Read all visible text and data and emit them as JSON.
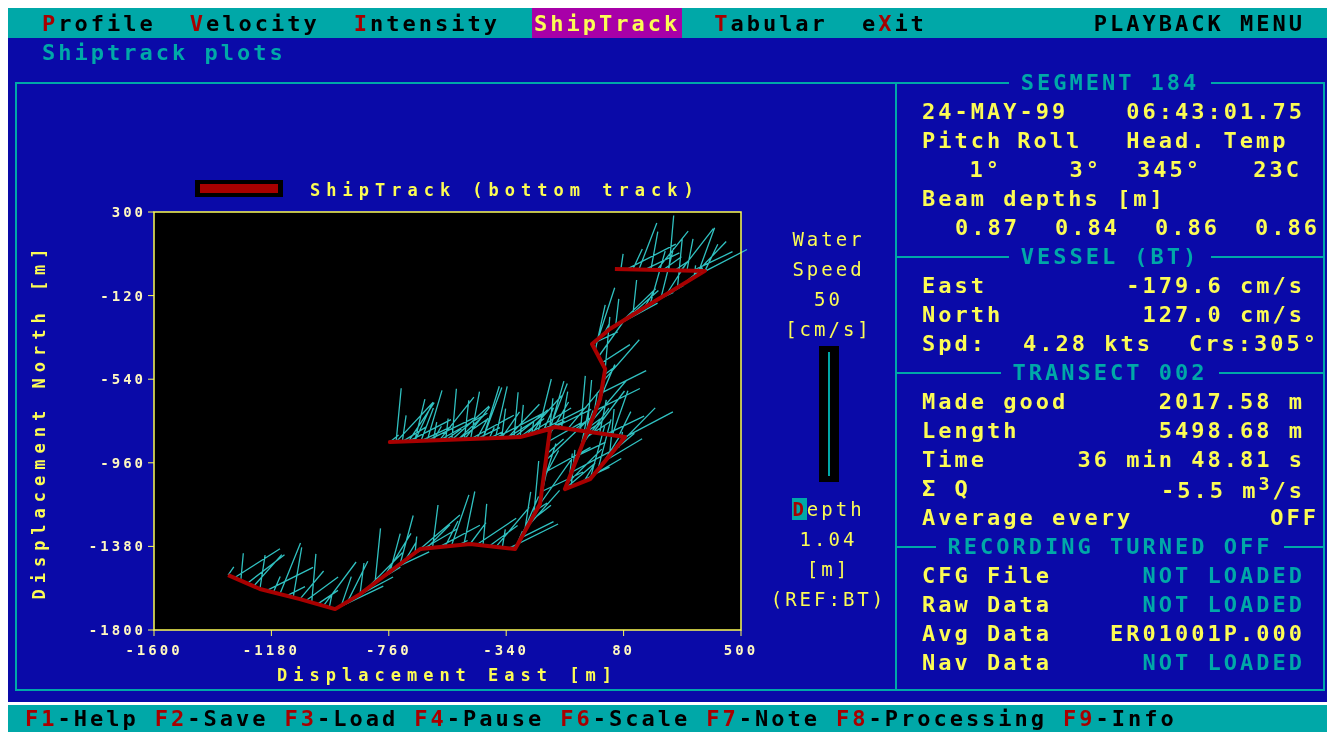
{
  "menu": {
    "items": [
      {
        "key": "P",
        "post": "rofile",
        "selected": false
      },
      {
        "key": "V",
        "post": "elocity",
        "selected": false
      },
      {
        "key": "I",
        "post": "ntensity",
        "selected": false
      },
      {
        "key": "S",
        "post": "hipTrack",
        "selected": true
      },
      {
        "key": "T",
        "post": "abular",
        "selected": false
      },
      {
        "pre": "e",
        "key": "X",
        "post": "it",
        "selected": false
      }
    ],
    "title": "PLAYBACK MENU"
  },
  "subtitle": "Shiptrack plots",
  "chart": {
    "chart_data": {
      "type": "line",
      "xlabel": "Displacement East [m]",
      "ylabel": "Displacement North [m]",
      "xlim": [
        -1600,
        500
      ],
      "ylim": [
        -1800,
        300
      ],
      "xticks": [
        -1600,
        -1180,
        -760,
        -340,
        80,
        500
      ],
      "yticks": [
        300,
        -120,
        -540,
        -960,
        -1380,
        -1800
      ],
      "x": [
        -1335,
        -1221,
        -1078,
        -952,
        -863,
        -648,
        -469,
        -308,
        -219,
        -183,
        -290,
        -756,
        -290,
        -165,
        85,
        -40,
        -130,
        -4,
        14,
        -33,
        31,
        175,
        371,
        49
      ],
      "series": [
        {
          "name": "ShipTrack (bottom track)",
          "color": "#a80000",
          "values": [
            -1524,
            -1594,
            -1645,
            -1695,
            -1620,
            -1393,
            -1368,
            -1393,
            -1167,
            -790,
            -831,
            -856,
            -831,
            -780,
            -831,
            -1042,
            -1092,
            -640,
            -489,
            -363,
            -288,
            -162,
            4,
            14
          ]
        }
      ]
    }
  },
  "water_speed": {
    "label_lines": [
      "Water",
      "Speed"
    ],
    "value": "50",
    "unit": "[cm/s]"
  },
  "depth": {
    "key": "D",
    "rest": "epth",
    "value": "1.04",
    "unit": "[m]",
    "reference": "(REF:BT)"
  },
  "info_panel": {
    "sections": [
      {
        "title": "SEGMENT 184",
        "rows": [
          {
            "kind": "pair",
            "label": "24-MAY-99",
            "value": "06:43:01.75"
          },
          {
            "kind": "headers",
            "cells": [
              "Pitch",
              "Roll",
              "Head.",
              "Temp"
            ]
          },
          {
            "kind": "values",
            "cells": [
              "1°",
              "3°",
              "345°",
              "23C"
            ]
          },
          {
            "kind": "text",
            "label": "Beam depths [m]"
          },
          {
            "kind": "values",
            "cells": [
              "0.87",
              "0.84",
              "0.86",
              "0.86"
            ]
          }
        ]
      },
      {
        "title": "VESSEL (BT)",
        "rows": [
          {
            "kind": "pair",
            "label": "East",
            "value": "-179.6 cm/s"
          },
          {
            "kind": "pair",
            "label": "North",
            "value": "127.0 cm/s"
          },
          {
            "kind": "triple",
            "label": "Spd:",
            "value": "4.28 kts",
            "value_2": "Crs:305°"
          }
        ]
      },
      {
        "title": "TRANSECT 002",
        "rows": [
          {
            "kind": "pair",
            "label": "Made good",
            "value": "2017.58 m"
          },
          {
            "kind": "pair",
            "label": "Length",
            "value": "5498.68 m"
          },
          {
            "kind": "pair",
            "label": "Time",
            "value": "36 min 48.81 s"
          },
          {
            "kind": "pair",
            "label": "Σ Q",
            "value": "-5.5 m$^{3}$/s"
          },
          {
            "kind": "pair",
            "label": "Average every",
            "value": "OFF"
          }
        ]
      },
      {
        "title": "RECORDING TURNED OFF",
        "rows": [
          {
            "kind": "status",
            "label": "CFG File",
            "value": "NOT LOADED",
            "loaded": false
          },
          {
            "kind": "status",
            "label": "Raw Data",
            "value": "NOT LOADED",
            "loaded": false
          },
          {
            "kind": "status",
            "label": "Avg Data",
            "value": "ER01001P.000",
            "loaded": true
          },
          {
            "kind": "status",
            "label": "Nav Data",
            "value": "NOT LOADED",
            "loaded": false
          }
        ]
      }
    ]
  },
  "function_keys": [
    {
      "key": "F1",
      "label": "-Help"
    },
    {
      "key": "F2",
      "label": "-Save"
    },
    {
      "key": "F3",
      "label": "-Load"
    },
    {
      "key": "F4",
      "label": "-Pause"
    },
    {
      "key": "F6",
      "label": "-Scale"
    },
    {
      "key": "F7",
      "label": "-Note"
    },
    {
      "key": "F8",
      "label": "-Processing"
    },
    {
      "key": "F9",
      "label": "-Info"
    }
  ]
}
